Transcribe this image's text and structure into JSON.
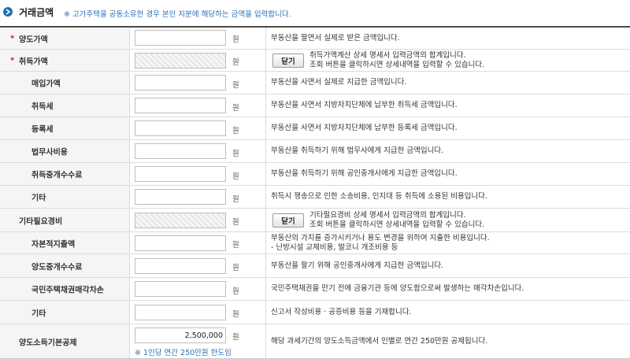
{
  "header": {
    "title": "거래금액",
    "note": "※ 고가주택을 공동소유한 경우 본인 지분에 해당하는 금액을 입력합니다."
  },
  "unit": "원",
  "toggle_label": "닫기",
  "rows": {
    "sale_price": {
      "label": "양도가액",
      "required_mark": "*",
      "value": "",
      "desc": "부동산을 팔면서 실제로 받은 금액입니다."
    },
    "acquisition_price": {
      "label": "취득가액",
      "required_mark": "*",
      "value": "",
      "desc_line1": "취득가액계산 상세 명세서 입력금액의 합계입니다.",
      "desc_line2": "조회 버튼을 클릭하시면 상세내역을 입력할 수 있습니다."
    },
    "purchase_price": {
      "label": "매입가액",
      "value": "",
      "desc": "부동산을 사면서 실제로 지급한 금액입니다."
    },
    "acquisition_tax": {
      "label": "취득세",
      "value": "",
      "desc": "부동산을 사면서 지방자치단체에 납부한 취득세 금액입니다."
    },
    "registration_tax": {
      "label": "등록세",
      "value": "",
      "desc": "부동산을 사면서 지방자치단체에 납부한 등록세 금액입니다."
    },
    "legal_fee": {
      "label": "법무사비용",
      "value": "",
      "desc": "부동산을 취득하기 위해 법무사에게 지급한 금액입니다."
    },
    "acquisition_brokerage": {
      "label": "취득중개수수료",
      "value": "",
      "desc": "부동산을 취득하기 위해 공인중개사에게 지급한 금액입니다."
    },
    "other_acquisition": {
      "label": "기타",
      "value": "",
      "desc": "취득시 쟁송으로 인한 소송비용, 인지대 등 취득에 소용된 비용입니다."
    },
    "other_expenses": {
      "label": "기타필요경비",
      "value": "",
      "desc_line1": "기타필요경비 상세 명세서 입력금액의 합계입니다.",
      "desc_line2": "조회 버튼을 클릭하시면 상세내역을 입력할 수 있습니다."
    },
    "capital_expenditure": {
      "label": "자본적지출액",
      "value": "",
      "desc_line1": "부동산의 가치를 증가시키거나 용도 변경을 위하여 지출한 비용입니다.",
      "desc_line2": "- 난방시설 교체비용, 발코니 개조비용 등"
    },
    "transfer_brokerage": {
      "label": "양도중개수수료",
      "value": "",
      "desc": "부동산을 팔기 위해 공인중개사에게 지급한 금액입니다."
    },
    "bond_loss": {
      "label": "국민주택채권매각차손",
      "value": "",
      "desc": "국민주택채권을 만기 전에 금융기관 등에 양도함으로써 발생하는 매각차손입니다."
    },
    "other_transfer": {
      "label": "기타",
      "value": "",
      "desc": "신고서 작성비용 · 공증비용 등을 기재합니다."
    },
    "basic_deduction": {
      "label": "양도소득기본공제",
      "value": "2,500,000",
      "limit_note": "※ 1인당 연간 250만원 한도임",
      "desc": "해당 과세기간의 양도소득금액에서 인별로 연간 250만원 공제됩니다."
    }
  },
  "colors": {
    "accent_blue": "#1f6fb3",
    "required_red": "#c8201f",
    "note_blue": "#2a6fb8"
  }
}
